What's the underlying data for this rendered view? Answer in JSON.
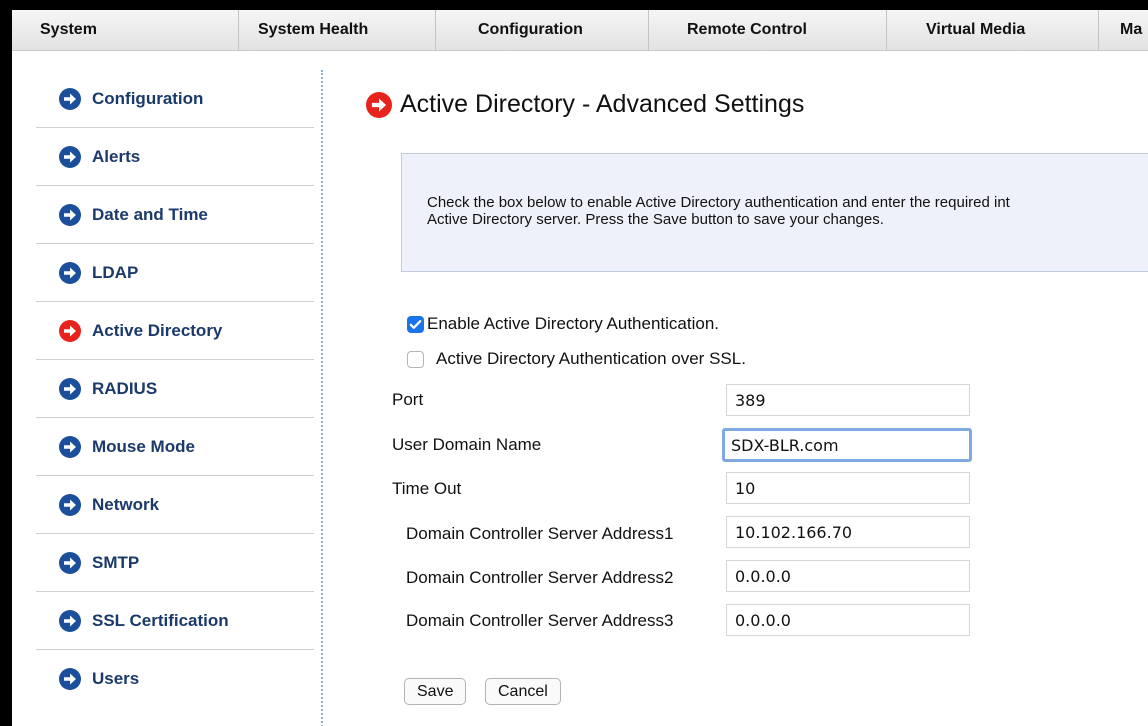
{
  "nav": {
    "tabs": [
      {
        "label": "System"
      },
      {
        "label": "System Health"
      },
      {
        "label": "Configuration"
      },
      {
        "label": "Remote Control"
      },
      {
        "label": "Virtual Media"
      },
      {
        "label": "Ma"
      }
    ]
  },
  "sidebar": {
    "items": [
      {
        "label": "Configuration",
        "active": false
      },
      {
        "label": "Alerts",
        "active": false
      },
      {
        "label": "Date and Time",
        "active": false
      },
      {
        "label": "LDAP",
        "active": false
      },
      {
        "label": "Active Directory",
        "active": true
      },
      {
        "label": "RADIUS",
        "active": false
      },
      {
        "label": "Mouse Mode",
        "active": false
      },
      {
        "label": "Network",
        "active": false
      },
      {
        "label": "SMTP",
        "active": false
      },
      {
        "label": "SSL Certification",
        "active": false
      },
      {
        "label": "Users",
        "active": false
      }
    ]
  },
  "page": {
    "title": "Active Directory - Advanced Settings",
    "info_line1": "Check the box below to enable Active Directory authentication and enter the required int",
    "info_line2": "Active Directory server. Press the Save button to save your changes."
  },
  "options": {
    "enable_ad": {
      "label": "Enable Active Directory Authentication.",
      "checked": true
    },
    "ad_ssl": {
      "label": "Active Directory Authentication over SSL.",
      "checked": false
    }
  },
  "fields": {
    "port": {
      "label": "Port",
      "value": "389"
    },
    "user_domain": {
      "label": "User Domain Name",
      "value": "SDX-BLR.com"
    },
    "timeout": {
      "label": "Time Out",
      "value": "10"
    },
    "dc1": {
      "label": "Domain Controller Server Address1",
      "value": "10.102.166.70"
    },
    "dc2": {
      "label": "Domain Controller Server Address2",
      "value": "0.0.0.0"
    },
    "dc3": {
      "label": "Domain Controller Server Address3",
      "value": "0.0.0.0"
    }
  },
  "buttons": {
    "save": "Save",
    "cancel": "Cancel"
  },
  "colors": {
    "nav_arrow": "#1b4f9c",
    "active_arrow": "#e8221c",
    "sidebar_text": "#1b3a6b",
    "checkbox": "#1a73e8"
  }
}
